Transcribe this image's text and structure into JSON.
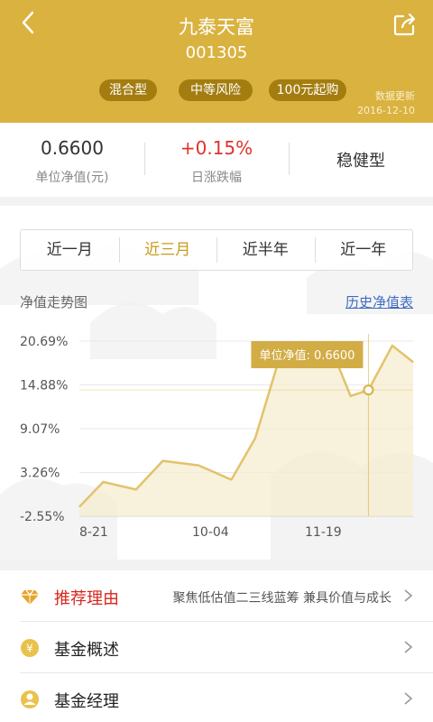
{
  "header": {
    "fund_name": "九泰天富",
    "fund_code": "001305",
    "tags": [
      "混合型",
      "中等风险",
      "100元起购"
    ],
    "update_label": "数据更新",
    "update_date": "2016-12-10"
  },
  "stats": {
    "nav_value": "0.6600",
    "nav_label": "单位净值(元)",
    "daily_change": "+0.15%",
    "daily_change_label": "日涨跌幅",
    "risk_style": "稳健型"
  },
  "tabs": [
    {
      "label": "近一月",
      "active": false
    },
    {
      "label": "近三月",
      "active": true
    },
    {
      "label": "近半年",
      "active": false
    },
    {
      "label": "近一年",
      "active": false
    }
  ],
  "chart_section": {
    "title": "净值走势图",
    "history_link": "历史净值表",
    "tooltip": "单位净值: 0.6600"
  },
  "chart_data": {
    "type": "area",
    "title": "",
    "xlabel": "",
    "ylabel": "",
    "y_tick_labels": [
      "20.69%",
      "14.88%",
      "9.07%",
      "3.26%",
      "-2.55%"
    ],
    "y_ticks": [
      20.69,
      14.88,
      9.07,
      3.26,
      -2.55
    ],
    "ylim": [
      -2.55,
      20.69
    ],
    "x_tick_labels": [
      "8-21",
      "10-04",
      "11-19"
    ],
    "x_tick_index": [
      0,
      44,
      88
    ],
    "x": [
      0,
      8,
      19,
      28,
      40,
      51,
      59,
      68,
      79,
      87,
      91,
      97,
      105,
      112
    ],
    "values": [
      -1.3,
      2.0,
      1.0,
      4.8,
      4.2,
      2.3,
      7.8,
      19.6,
      20.3,
      17.3,
      13.4,
      14.2,
      20.1,
      17.9
    ],
    "selected_index": 11,
    "colors": {
      "line": "#e2c36b",
      "fill": "#f6ecd0",
      "accent": "#d9b23f"
    }
  },
  "menu": [
    {
      "label": "推荐理由",
      "desc": "聚焦低估值二三线蓝筹  兼具价值与成长",
      "icon": "diamond-icon",
      "highlight": true
    },
    {
      "label": "基金概述",
      "desc": "",
      "icon": "yen-coin-icon",
      "highlight": false
    },
    {
      "label": "基金经理",
      "desc": "",
      "icon": "manager-icon",
      "highlight": false
    }
  ],
  "colors": {
    "brand": "#d9b23f",
    "up": "#e0322c",
    "link": "#3d6bc4"
  }
}
